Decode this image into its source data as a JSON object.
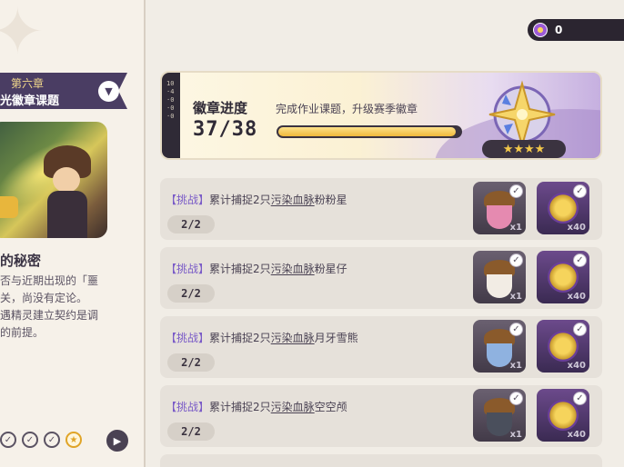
{
  "chapter": {
    "number": "第六章",
    "name": "光徽章课题",
    "subtitle": "的秘密",
    "description": [
      "否与近期出现的「噩",
      "关，尚没有定论。",
      "遇精灵建立契约是调",
      "的前提。"
    ]
  },
  "currency": {
    "value": "0"
  },
  "badge": {
    "title": "徽章进度",
    "hint": "完成作业课题，升级赛季徽章",
    "current": 37,
    "total": 38,
    "count_text": "37/38",
    "stars": "★★★★",
    "stripe_text": "10·4·0·0·0"
  },
  "tasks": [
    {
      "tag": "【挑战】",
      "text_prefix": "累计捕捉2只",
      "target": "污染血脉",
      "text_suffix": "粉粉星",
      "progress": "2/2",
      "rewards": [
        {
          "qty": "x1",
          "icon": "acorn-pink-icon"
        },
        {
          "qty": "x40",
          "icon": "coin-icon"
        }
      ]
    },
    {
      "tag": "【挑战】",
      "text_prefix": "累计捕捉2只",
      "target": "污染血脉",
      "text_suffix": "粉星仔",
      "progress": "2/2",
      "rewards": [
        {
          "qty": "x1",
          "icon": "acorn-white-icon"
        },
        {
          "qty": "x40",
          "icon": "coin-icon"
        }
      ]
    },
    {
      "tag": "【挑战】",
      "text_prefix": "累计捕捉2只",
      "target": "污染血脉",
      "text_suffix": "月牙雪熊",
      "progress": "2/2",
      "rewards": [
        {
          "qty": "x1",
          "icon": "acorn-blue-icon"
        },
        {
          "qty": "x40",
          "icon": "coin-icon"
        }
      ]
    },
    {
      "tag": "【挑战】",
      "text_prefix": "累计捕捉2只",
      "target": "污染血脉",
      "text_suffix": "空空颅",
      "progress": "2/2",
      "rewards": [
        {
          "qty": "x1",
          "icon": "acorn-gray-icon"
        },
        {
          "qty": "x40",
          "icon": "coin-icon"
        }
      ]
    }
  ],
  "colors": {
    "accent_purple": "#4a3d63",
    "tag_purple": "#7a5bc7",
    "gold": "#f0b83a"
  }
}
